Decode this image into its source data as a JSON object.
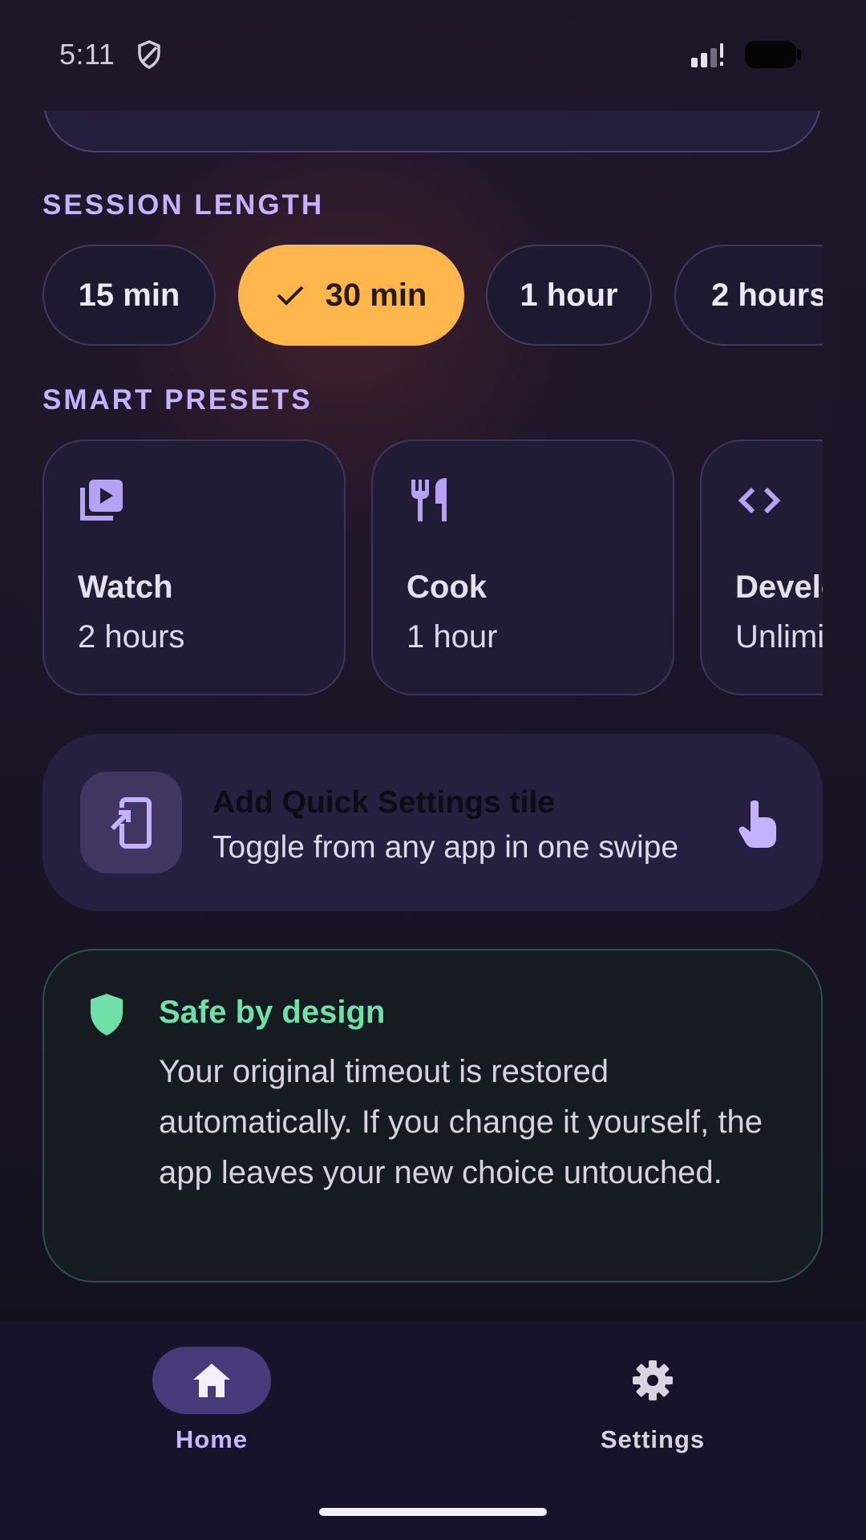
{
  "status_bar": {
    "time": "5:11",
    "icons": [
      "shield-outline-icon",
      "signal-icon",
      "battery-icon"
    ]
  },
  "session_length": {
    "label": "SESSION LENGTH",
    "options": [
      {
        "label": "15 min",
        "selected": false
      },
      {
        "label": "30 min",
        "selected": true
      },
      {
        "label": "1 hour",
        "selected": false
      },
      {
        "label": "2 hours",
        "selected": false
      }
    ]
  },
  "smart_presets": {
    "label": "SMART PRESETS",
    "items": [
      {
        "icon": "video-library-icon",
        "title": "Watch",
        "duration": "2 hours"
      },
      {
        "icon": "fork-knife-icon",
        "title": "Cook",
        "duration": "1 hour"
      },
      {
        "icon": "code-icon",
        "title": "Develop",
        "duration": "Unlimited"
      }
    ]
  },
  "quick_settings_tile": {
    "icon": "add-to-screen-icon",
    "title": "Add Quick Settings tile",
    "subtitle": "Toggle from any app in one swipe",
    "action_icon": "touch-icon"
  },
  "safe_by_design": {
    "icon": "shield-icon",
    "title": "Safe by design",
    "body": "Your original timeout is restored automatically. If you change it yourself, the app leaves your new choice untouched."
  },
  "bottom_nav": {
    "items": [
      {
        "icon": "home-icon",
        "label": "Home",
        "active": true
      },
      {
        "icon": "gear-icon",
        "label": "Settings",
        "active": false
      }
    ]
  },
  "colors": {
    "accent": "#c4b2ff",
    "selected_chip": "#ffb74d",
    "safe_green": "#6ee0a8",
    "nav_active_pill": "#463a7a"
  }
}
